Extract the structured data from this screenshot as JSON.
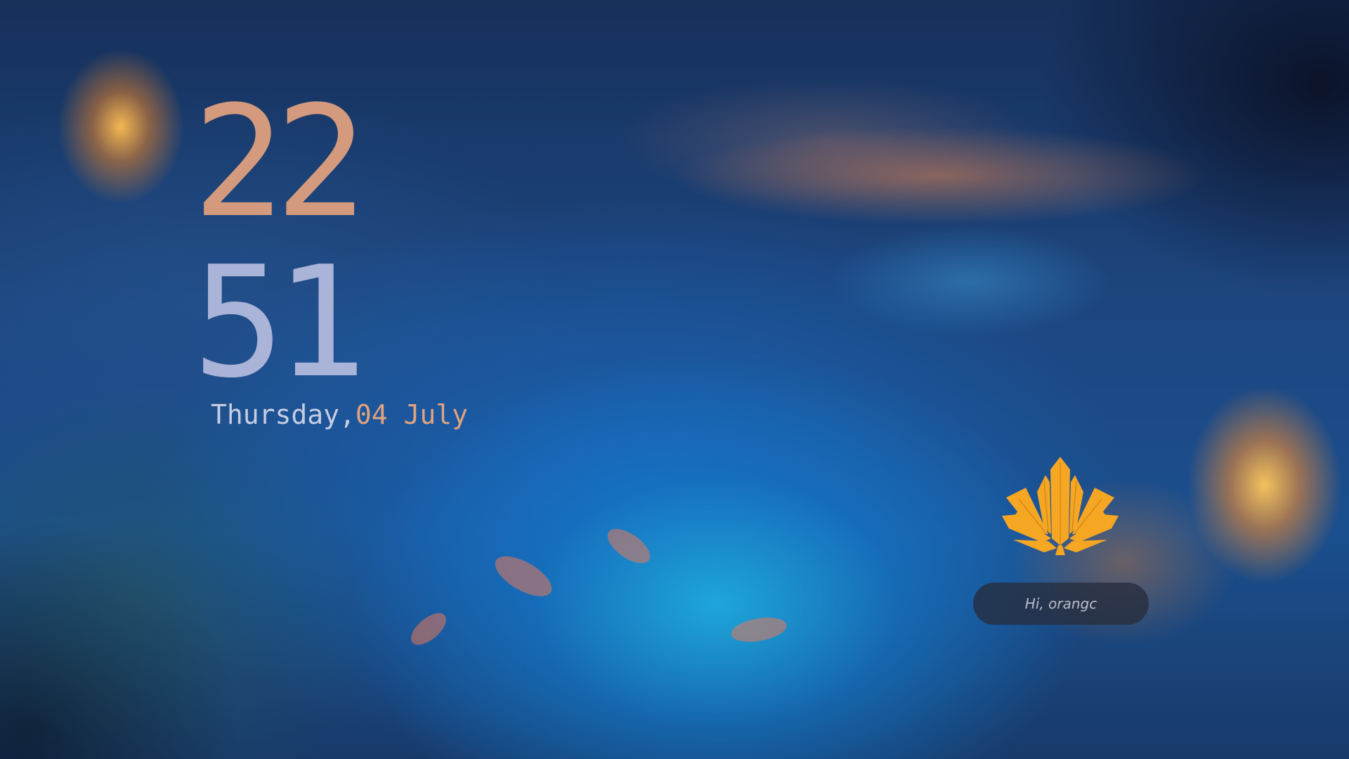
{
  "lockscreen": {
    "clock": {
      "hours": "22",
      "minutes": "51"
    },
    "date": {
      "weekday": "Thursday,",
      "day_month": "04 July"
    },
    "greeting": "Hi, orangc",
    "avatar_icon": "maple-leaf-icon",
    "colors": {
      "hours": "#d49a7d",
      "minutes": "#aab3d8",
      "accent": "#e0a27f",
      "avatar": "#f5a623"
    }
  }
}
